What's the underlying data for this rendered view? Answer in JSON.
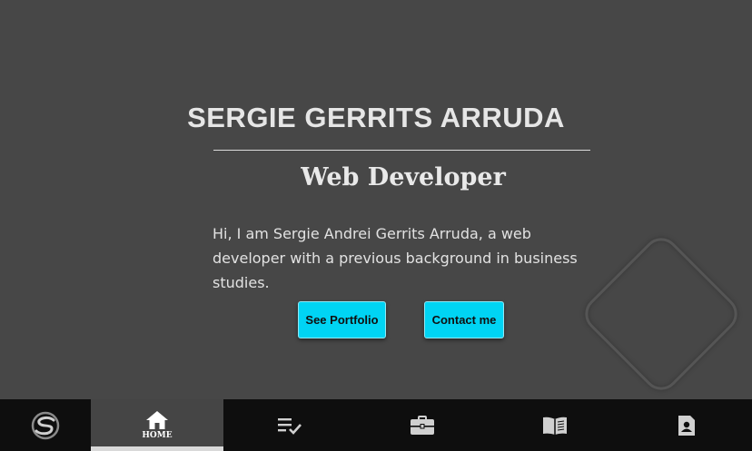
{
  "hero": {
    "name": "SERGIE GERRITS ARRUDA",
    "role": "Web Developer",
    "intro": "Hi, I am Sergie Andrei Gerrits Arruda, a web developer with a previous background in business studies.",
    "portfolio_button": "See Portfolio",
    "contact_button": "Contact me"
  },
  "nav": {
    "items": [
      {
        "label": "HOME",
        "icon": "home-icon",
        "active": true
      },
      {
        "label": "",
        "icon": "checklist-icon",
        "active": false
      },
      {
        "label": "",
        "icon": "briefcase-icon",
        "active": false
      },
      {
        "label": "",
        "icon": "book-icon",
        "active": false
      },
      {
        "label": "",
        "icon": "contact-card-icon",
        "active": false
      }
    ]
  },
  "colors": {
    "background": "#474747",
    "accent": "#00d4f4",
    "navbar": "#0e0e0e"
  }
}
